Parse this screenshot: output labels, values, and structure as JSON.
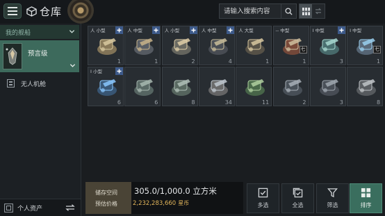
{
  "header": {
    "title": "仓库",
    "menu_icon": "hamburger-menu-icon",
    "search_placeholder": "请输入搜索内容"
  },
  "sidebar": {
    "dropdown_label": "我的舰船",
    "selected_ship": "预言级",
    "drone_bay_label": "无人机舱",
    "personal_assets_label": "个人资产"
  },
  "items": [
    {
      "size": "人 小型",
      "qty": "1",
      "plus": true,
      "tier": ""
    },
    {
      "size": "人 中型",
      "qty": "1",
      "plus": true,
      "tier": ""
    },
    {
      "size": "人 小型",
      "qty": "2",
      "plus": true,
      "tier": ""
    },
    {
      "size": "人 中型",
      "qty": "4",
      "plus": true,
      "tier": ""
    },
    {
      "size": "人 大型",
      "qty": "1",
      "plus": false,
      "tier": ""
    },
    {
      "size": "-- 中型",
      "qty": "1",
      "plus": false,
      "tier": "七"
    },
    {
      "size": "I 中型",
      "qty": "3",
      "plus": true,
      "tier": ""
    },
    {
      "size": "I 中型",
      "qty": "1",
      "plus": false,
      "tier": "七"
    },
    {
      "size": "I 小型",
      "qty": "6",
      "plus": true,
      "tier": ""
    },
    {
      "size": "",
      "qty": "6",
      "plus": false,
      "tier": ""
    },
    {
      "size": "",
      "qty": "8",
      "plus": false,
      "tier": ""
    },
    {
      "size": "",
      "qty": "34",
      "plus": false,
      "tier": ""
    },
    {
      "size": "",
      "qty": "11",
      "plus": false,
      "tier": ""
    },
    {
      "size": "",
      "qty": "2",
      "plus": false,
      "tier": ""
    },
    {
      "size": "",
      "qty": "3",
      "plus": false,
      "tier": ""
    },
    {
      "size": "",
      "qty": "8",
      "plus": false,
      "tier": ""
    }
  ],
  "bottom": {
    "capacity_label": "储存空间",
    "capacity_value": "305.0/1,000.0 立方米",
    "price_label": "预估价格",
    "price_value": "2,232,283,660",
    "price_unit": "星币"
  },
  "actions": {
    "multi_select": "多选",
    "select_all": "全选",
    "filter": "筛选",
    "sort": "排序"
  },
  "colors": {
    "accent_green": "#3d6a5c",
    "price_gold": "#e0b45a",
    "plus_blue": "#3d5a8a"
  }
}
